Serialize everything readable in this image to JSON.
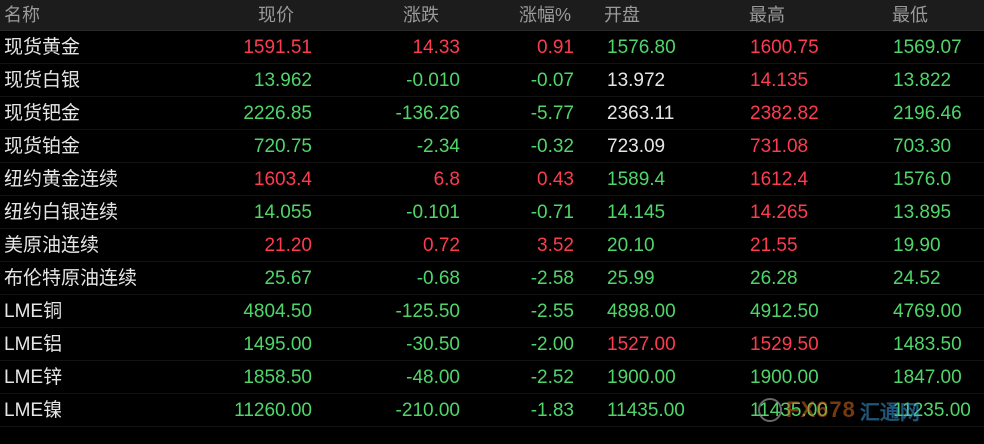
{
  "headers": {
    "name": "名称",
    "price": "现价",
    "change": "涨跌",
    "change_pct": "涨幅%",
    "open": "开盘",
    "high": "最高",
    "low": "最低"
  },
  "colors": {
    "up": "#ff3b4e",
    "down": "#4fd66a",
    "neutral": "#e6e6e6",
    "header_bg": "#1c1c1c",
    "background": "#000000"
  },
  "rows": [
    {
      "name": "现货黄金",
      "price": "1591.51",
      "change": "14.33",
      "change_pct": "0.91",
      "open": "1576.80",
      "high": "1600.75",
      "low": "1569.07",
      "colors": {
        "price": "red",
        "change": "red",
        "change_pct": "red",
        "open": "green",
        "high": "red",
        "low": "green"
      }
    },
    {
      "name": "现货白银",
      "price": "13.962",
      "change": "-0.010",
      "change_pct": "-0.07",
      "open": "13.972",
      "high": "14.135",
      "low": "13.822",
      "colors": {
        "price": "green",
        "change": "green",
        "change_pct": "green",
        "open": "white",
        "high": "red",
        "low": "green"
      }
    },
    {
      "name": "现货钯金",
      "price": "2226.85",
      "change": "-136.26",
      "change_pct": "-5.77",
      "open": "2363.11",
      "high": "2382.82",
      "low": "2196.46",
      "colors": {
        "price": "green",
        "change": "green",
        "change_pct": "green",
        "open": "white",
        "high": "red",
        "low": "green"
      }
    },
    {
      "name": "现货铂金",
      "price": "720.75",
      "change": "-2.34",
      "change_pct": "-0.32",
      "open": "723.09",
      "high": "731.08",
      "low": "703.30",
      "colors": {
        "price": "green",
        "change": "green",
        "change_pct": "green",
        "open": "white",
        "high": "red",
        "low": "green"
      }
    },
    {
      "name": "纽约黄金连续",
      "price": "1603.4",
      "change": "6.8",
      "change_pct": "0.43",
      "open": "1589.4",
      "high": "1612.4",
      "low": "1576.0",
      "colors": {
        "price": "red",
        "change": "red",
        "change_pct": "red",
        "open": "green",
        "high": "red",
        "low": "green"
      }
    },
    {
      "name": "纽约白银连续",
      "price": "14.055",
      "change": "-0.101",
      "change_pct": "-0.71",
      "open": "14.145",
      "high": "14.265",
      "low": "13.895",
      "colors": {
        "price": "green",
        "change": "green",
        "change_pct": "green",
        "open": "green",
        "high": "red",
        "low": "green"
      }
    },
    {
      "name": "美原油连续",
      "price": "21.20",
      "change": "0.72",
      "change_pct": "3.52",
      "open": "20.10",
      "high": "21.55",
      "low": "19.90",
      "colors": {
        "price": "red",
        "change": "red",
        "change_pct": "red",
        "open": "green",
        "high": "red",
        "low": "green"
      }
    },
    {
      "name": "布伦特原油连续",
      "price": "25.67",
      "change": "-0.68",
      "change_pct": "-2.58",
      "open": "25.99",
      "high": "26.28",
      "low": "24.52",
      "colors": {
        "price": "green",
        "change": "green",
        "change_pct": "green",
        "open": "green",
        "high": "green",
        "low": "green"
      }
    },
    {
      "name": "LME铜",
      "price": "4804.50",
      "change": "-125.50",
      "change_pct": "-2.55",
      "open": "4898.00",
      "high": "4912.50",
      "low": "4769.00",
      "colors": {
        "price": "green",
        "change": "green",
        "change_pct": "green",
        "open": "green",
        "high": "green",
        "low": "green"
      }
    },
    {
      "name": "LME铝",
      "price": "1495.00",
      "change": "-30.50",
      "change_pct": "-2.00",
      "open": "1527.00",
      "high": "1529.50",
      "low": "1483.50",
      "colors": {
        "price": "green",
        "change": "green",
        "change_pct": "green",
        "open": "red",
        "high": "red",
        "low": "green"
      }
    },
    {
      "name": "LME锌",
      "price": "1858.50",
      "change": "-48.00",
      "change_pct": "-2.52",
      "open": "1900.00",
      "high": "1900.00",
      "low": "1847.00",
      "colors": {
        "price": "green",
        "change": "green",
        "change_pct": "green",
        "open": "green",
        "high": "green",
        "low": "green"
      }
    },
    {
      "name": "LME镍",
      "price": "11260.00",
      "change": "-210.00",
      "change_pct": "-1.83",
      "open": "11435.00",
      "high": "11435.00",
      "low": "11235.00",
      "colors": {
        "price": "green",
        "change": "green",
        "change_pct": "green",
        "open": "green",
        "high": "green",
        "low": "green"
      }
    }
  ],
  "watermark": {
    "logo_icon": "fx678-logo-icon",
    "text": "FX678",
    "cn": "汇通网"
  }
}
